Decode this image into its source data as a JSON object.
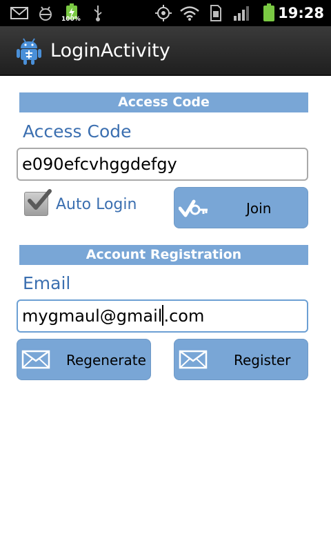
{
  "status_bar": {
    "battery_percent": "100%",
    "time": "19:28"
  },
  "title_bar": {
    "title": "LoginActivity"
  },
  "access_section": {
    "header": "Access Code",
    "label": "Access Code",
    "value": "e090efcvhggdefgy",
    "auto_login_label": "Auto Login",
    "auto_login_checked": true,
    "join_label": "Join"
  },
  "registration_section": {
    "header": "Account Registration",
    "label": "Email",
    "value_before_caret": "mygmaul@gmail",
    "value_after_caret": ".com",
    "regenerate_label": "Regenerate",
    "register_label": "Register"
  },
  "colors": {
    "accent": "#79a6d6",
    "label_text": "#3b6fb0"
  }
}
